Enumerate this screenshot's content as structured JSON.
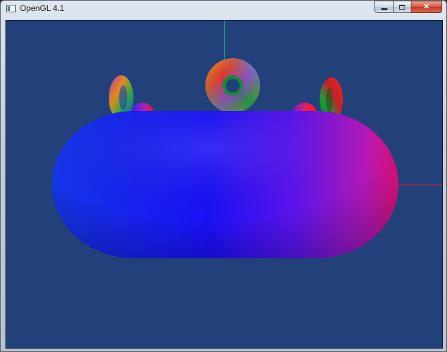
{
  "window": {
    "title": "OpenGL 4.1",
    "controls": {
      "minimize_icon": "minimize-icon",
      "maximize_icon": "maximize-icon",
      "close_icon": "close-icon",
      "close_glyph": "✕"
    }
  },
  "scene": {
    "background_color": "#22407a",
    "x_axis_color": "#d01c2c",
    "y_axis_color": "#1fd47a",
    "objects": [
      "large-torus",
      "torus-top-center",
      "torus-left-upright",
      "torus-right-upright",
      "torus-left-back",
      "torus-right-back"
    ]
  }
}
